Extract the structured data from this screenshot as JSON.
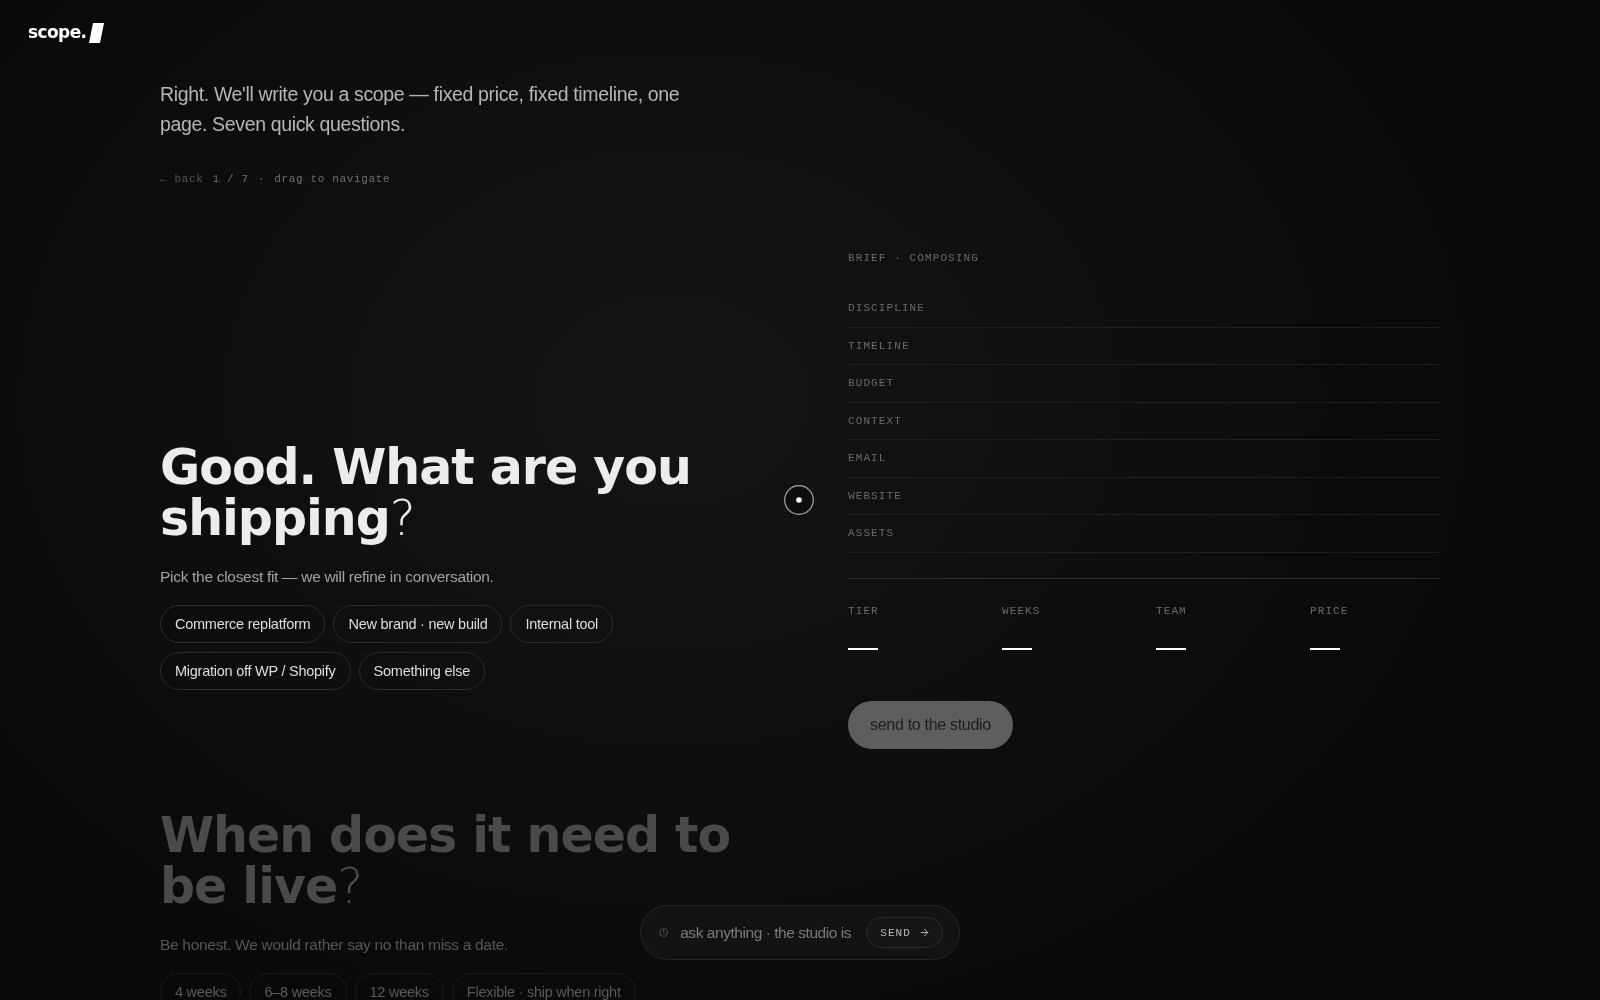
{
  "brand": {
    "name": "scope."
  },
  "intro": "Right. We'll write you a scope — fixed price, fixed timeline, one page. Seven quick questions.",
  "nav": {
    "back": {
      "label": "← back",
      "disabled": true
    },
    "position": "1 / 7",
    "separator": "·",
    "hint": "drag to navigate"
  },
  "questions": [
    {
      "headline": "**Good. What are you shipping**?",
      "hint": "Pick the closest fit — we will refine in conversation.",
      "focused": true,
      "options": [
        {
          "label": "Commerce replatform",
          "selected": false
        },
        {
          "label": "New brand · new build",
          "selected": false
        },
        {
          "label": "Internal tool",
          "selected": false
        },
        {
          "label": "Migration off WP / Shopify",
          "selected": false
        },
        {
          "label": "Something else",
          "selected": false
        }
      ]
    },
    {
      "headline": "**When does it need to be live**?",
      "hint": "Be honest. We would rather say no than miss a date.",
      "focused": false,
      "options": [
        {
          "label": "4 weeks",
          "selected": false
        },
        {
          "label": "6–8 weeks",
          "selected": false
        },
        {
          "label": "12 weeks",
          "selected": false
        },
        {
          "label": "Flexible · ship when right",
          "selected": false
        }
      ]
    }
  ],
  "brief": {
    "title": "BRIEF · COMPOSING",
    "fields": [
      {
        "label": "DISCIPLINE"
      },
      {
        "label": "TIMELINE"
      },
      {
        "label": "BUDGET"
      },
      {
        "label": "CONTEXT"
      },
      {
        "label": "EMAIL"
      },
      {
        "label": "WEBSITE"
      },
      {
        "label": "ASSETS"
      }
    ],
    "stats": [
      {
        "label": "TIER",
        "value": "—"
      },
      {
        "label": "WEEKS",
        "value": "—"
      },
      {
        "label": "TEAM",
        "value": "—"
      },
      {
        "label": "PRICE",
        "value": "—"
      }
    ],
    "submit": {
      "label": "send to the studio",
      "disabled": true
    }
  },
  "chat": {
    "placeholder": "ask anything · the studio is",
    "send": "SEND"
  }
}
